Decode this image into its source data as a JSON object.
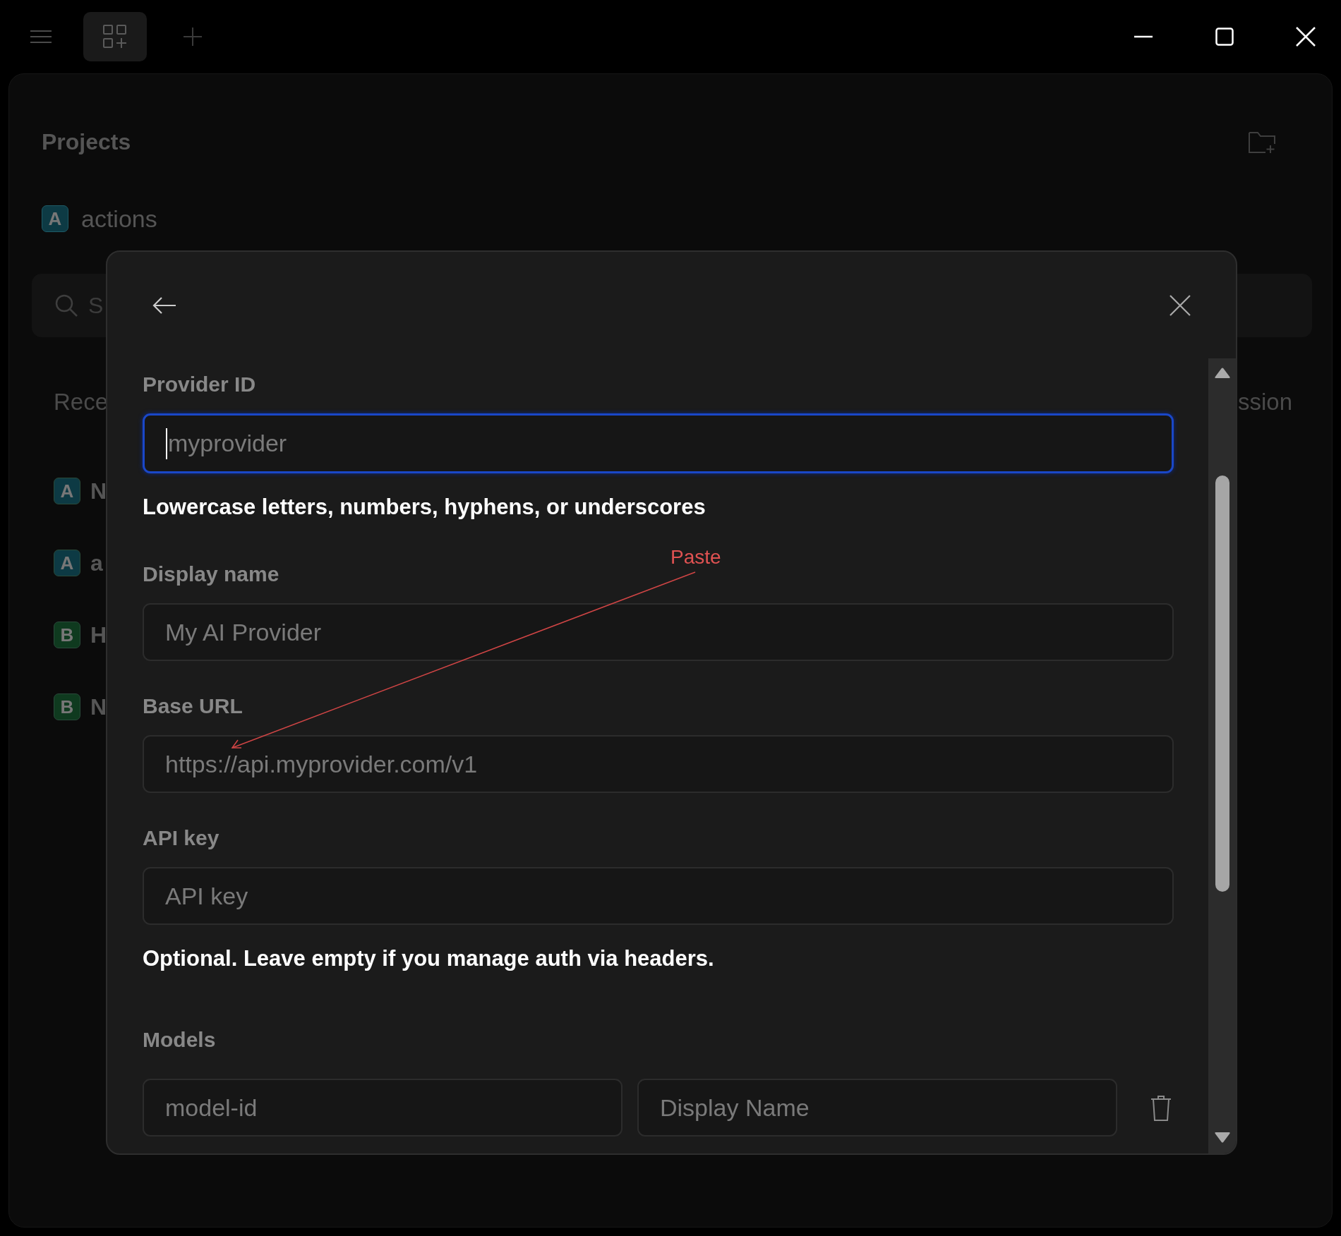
{
  "projects": {
    "title": "Projects",
    "items": [
      {
        "badge": "A",
        "name": "actions",
        "color": "#0d3a44"
      }
    ]
  },
  "search": {
    "placeholder": "S"
  },
  "recent": {
    "title": "Rece",
    "title_right": "ssion",
    "items": [
      {
        "badge": "A",
        "name": "N",
        "color": "#0d3a44"
      },
      {
        "badge": "A",
        "name": "a",
        "color": "#0d3a44"
      },
      {
        "badge": "B",
        "name": "H",
        "color": "#0f3a1f"
      },
      {
        "badge": "B",
        "name": "N",
        "color": "#0f3a1f"
      }
    ]
  },
  "dialog": {
    "fields": [
      {
        "label": "Provider ID",
        "placeholder": "myprovider",
        "focused": true,
        "hint": "Lowercase letters, numbers, hyphens, or underscores"
      },
      {
        "label": "Display name",
        "placeholder": "My AI Provider",
        "focused": false
      },
      {
        "label": "Base URL",
        "placeholder": "https://api.myprovider.com/v1",
        "focused": false
      },
      {
        "label": "API key",
        "placeholder": "API key",
        "focused": false,
        "hint": "Optional. Leave empty if you manage auth via headers."
      }
    ],
    "models": {
      "label": "Models",
      "rows": [
        {
          "id_placeholder": "model-id",
          "name_placeholder": "Display Name"
        }
      ]
    }
  },
  "annotation": {
    "text": "Paste"
  }
}
